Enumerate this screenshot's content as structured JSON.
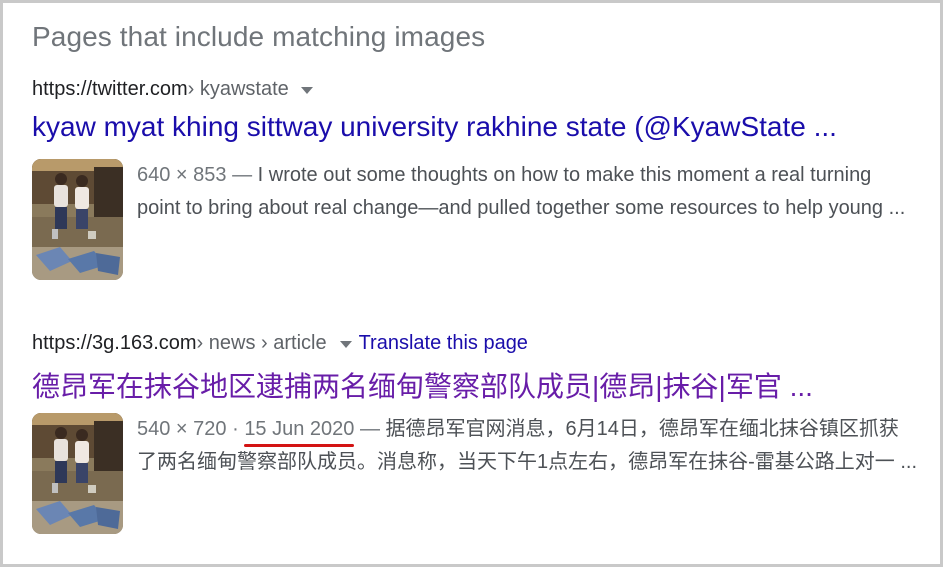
{
  "section": {
    "title": "Pages that include matching images"
  },
  "results": [
    {
      "cite_domain": "https://twitter.com",
      "cite_path": " › kyawstate",
      "title": "kyaw myat khing sittway university rakhine state (@KyawState ...",
      "dimensions": "640 × 853",
      "snippet_sep": " — ",
      "snippet": "I wrote out some thoughts on how to make this moment a real turning point to bring about real change—and pulled together some resources to help young ..."
    },
    {
      "cite_domain": "https://3g.163.com",
      "cite_path": " › news › article",
      "translate_label": "Translate this page",
      "title": "德昂军在抹谷地区逮捕两名缅甸警察部队成员|德昂|抹谷|军官 ...",
      "dimensions": "540 × 720",
      "dot_sep": " · ",
      "date": "15 Jun 2020",
      "snippet_sep": " — ",
      "snippet": "据德昂军官网消息，6月14日，德昂军在缅北抹谷镇区抓获了两名缅甸警察部队成员。消息称，当天下午1点左右，德昂军在抹谷-雷基公路上对一 ..."
    }
  ],
  "colors": {
    "link": "#1a0dab",
    "visited_link": "#681da8",
    "annotation_underline": "#d31313"
  }
}
